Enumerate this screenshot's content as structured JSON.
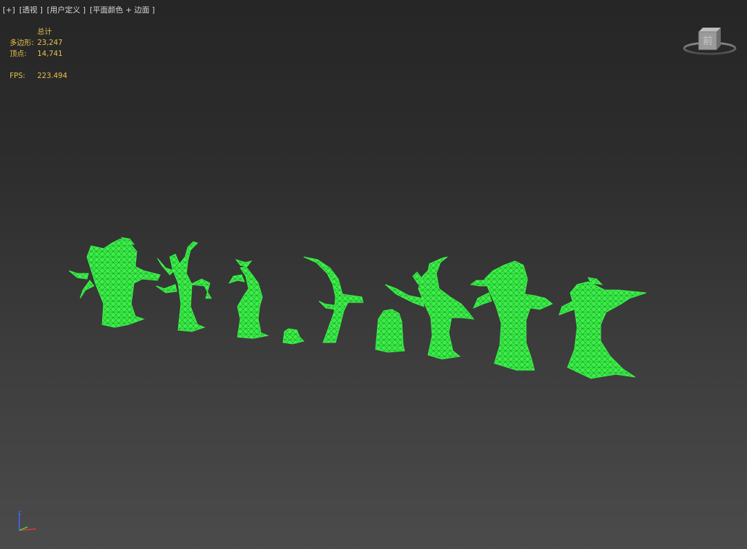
{
  "viewport": {
    "label_parts": [
      "[+]",
      "[透视 ]",
      "[用户定义 ]",
      "[平面颜色 + 边面 ]"
    ],
    "stats": {
      "header": "总计",
      "polygons_label": "多边形:",
      "polygons_value": "23,247",
      "vertices_label": "顶点:",
      "vertices_value": "14,741",
      "fps_label": "FPS:",
      "fps_value": "223.494"
    },
    "viewcube_face": "前",
    "axis_label": "z"
  },
  "colors": {
    "wireframe": "#3df04a",
    "wire_edge": "#1a9a24",
    "stats_text": "#e6c24a",
    "label_text": "#d8d8d8"
  },
  "objects": [
    {
      "name": "dead-tree-1"
    },
    {
      "name": "dead-tree-2"
    },
    {
      "name": "dead-tree-3"
    },
    {
      "name": "tree-stump"
    },
    {
      "name": "bent-tree"
    },
    {
      "name": "tombstone"
    },
    {
      "name": "dead-tree-4"
    },
    {
      "name": "dead-tree-5"
    },
    {
      "name": "dead-tree-6"
    }
  ]
}
